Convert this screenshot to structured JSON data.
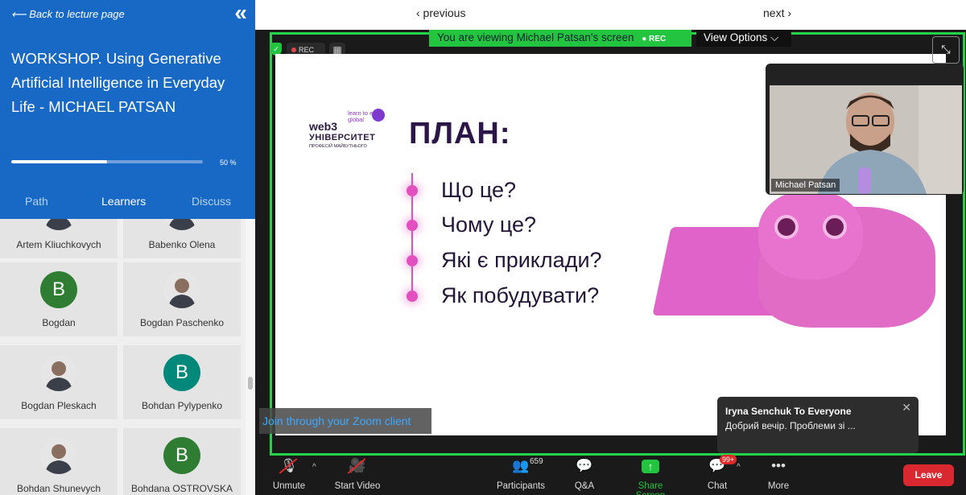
{
  "sidebar": {
    "back_label": "⟵ Back to lecture page",
    "collapse_icon": "«",
    "course_title": "WORKSHOP. Using Generative Artificial Intelligence in Everyday Life - MICHAEL PATSAN",
    "progress_value": 0.5,
    "progress_label": "50 %",
    "tabs": [
      {
        "label": "Path",
        "active": false
      },
      {
        "label": "Learners",
        "active": true
      },
      {
        "label": "Discuss",
        "active": false
      }
    ],
    "learners": [
      {
        "name": "Artem Kliuchkovych",
        "avatar": "photo"
      },
      {
        "name": "Babenko Olena",
        "avatar": "photo"
      },
      {
        "name": "Bogdan",
        "avatar": "letter",
        "letter": "B",
        "color": "#2e7d32"
      },
      {
        "name": "Bogdan Paschenko",
        "avatar": "photo"
      },
      {
        "name": "Bogdan Pleskach",
        "avatar": "photo"
      },
      {
        "name": "Bohdan Pylypenko",
        "avatar": "letter",
        "letter": "B",
        "color": "#00897b"
      },
      {
        "name": "Bohdan Shunevych",
        "avatar": "photo"
      },
      {
        "name": "Bohdana OSTROVSKA",
        "avatar": "letter",
        "letter": "B",
        "color": "#2e7d32"
      }
    ]
  },
  "topnav": {
    "previous_label": "‹ previous",
    "next_label": "next ›"
  },
  "zoom": {
    "viewing_banner": "You are viewing Michael Patsan's screen",
    "banner_rec": "● REC",
    "view_options_label": "View Options ⌵",
    "rec_label": "REC",
    "join_link": "Join through your Zoom client",
    "speaker_name": "Michael Patsan",
    "slide": {
      "logo_word": "web3",
      "logo_uni": "УНІВЕРСИТЕТ",
      "logo_sub": "ПРОФЕСІЙ МАЙБУТНЬОГО",
      "logo_tag": "learn to earn global",
      "title": "ПЛАН:",
      "bullets": [
        "Що це?",
        "Чому це?",
        "Які є приклади?",
        "Як побудувати?"
      ]
    },
    "chat_toast": {
      "from": "Iryna Senchuk To Everyone",
      "message": "Добрий вечір. Проблеми зі ..."
    },
    "toolbar": {
      "unmute": "Unmute",
      "start_video": "Start Video",
      "participants": "Participants",
      "participants_count": "659",
      "qa": "Q&A",
      "share_screen": "Share Screen",
      "chat": "Chat",
      "chat_badge": "99+",
      "more": "More",
      "leave": "Leave"
    }
  },
  "colors": {
    "sidebar_header": "#1769c5",
    "share_green": "#23c43f",
    "leave_red": "#d9282f",
    "slide_accent": "#e24fbf"
  }
}
